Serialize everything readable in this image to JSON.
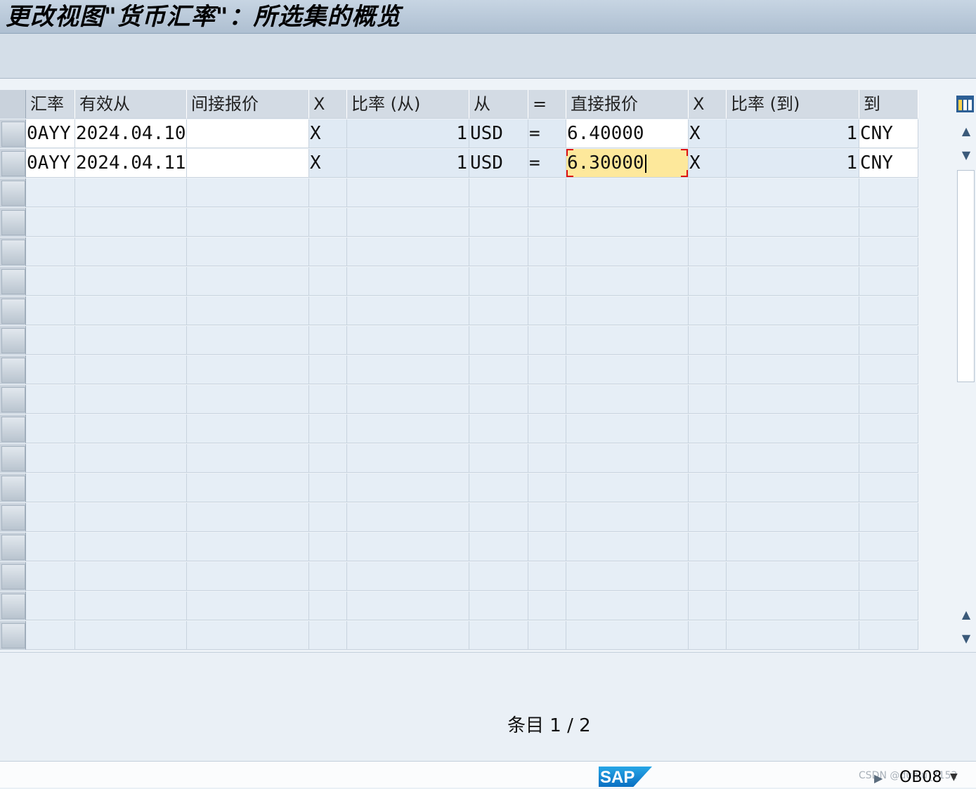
{
  "window": {
    "title": "更改视图\"货币汇率\"：所选集的概览"
  },
  "table": {
    "headers": [
      "汇率",
      "有效从",
      "间接报价",
      "X",
      "比率 (从)",
      "从",
      "=",
      "直接报价",
      "X",
      "比率 (到)",
      "到"
    ],
    "rows": [
      {
        "rate_type": "0AYY",
        "valid_from": "2024.04.10",
        "indirect_quote": "",
        "x1": "X",
        "ratio_from": "1",
        "from": "USD",
        "eq": "=",
        "direct_quote": "6.40000",
        "x2": "X",
        "ratio_to": "1",
        "to": "CNY"
      },
      {
        "rate_type": "0AYY",
        "valid_from": "2024.04.11",
        "indirect_quote": "",
        "x1": "X",
        "ratio_from": "1",
        "from": "USD",
        "eq": "=",
        "direct_quote": "6.30000",
        "x2": "X",
        "ratio_to": "1",
        "to": "CNY"
      }
    ],
    "empty_rows": 16,
    "focused_cell": {
      "row": 1,
      "column": "direct_quote"
    }
  },
  "footer": {
    "entries_label": "条目 1 / 2"
  },
  "statusbar": {
    "transaction_code": "OB08",
    "watermark": "CSDN @dunlu_7152",
    "logo": "SAP"
  },
  "colors": {
    "focus_bg": "#fde89b",
    "focus_corner": "#dd1111",
    "header_bg": "#d3dbe4",
    "title_bg": "#b8c8d8"
  },
  "icons": {
    "column_settings": "table-settings-icon",
    "scroll_up": "triangle-up-icon",
    "scroll_down": "triangle-down-icon",
    "dropdown": "chevron-down-icon",
    "play": "play-icon"
  }
}
